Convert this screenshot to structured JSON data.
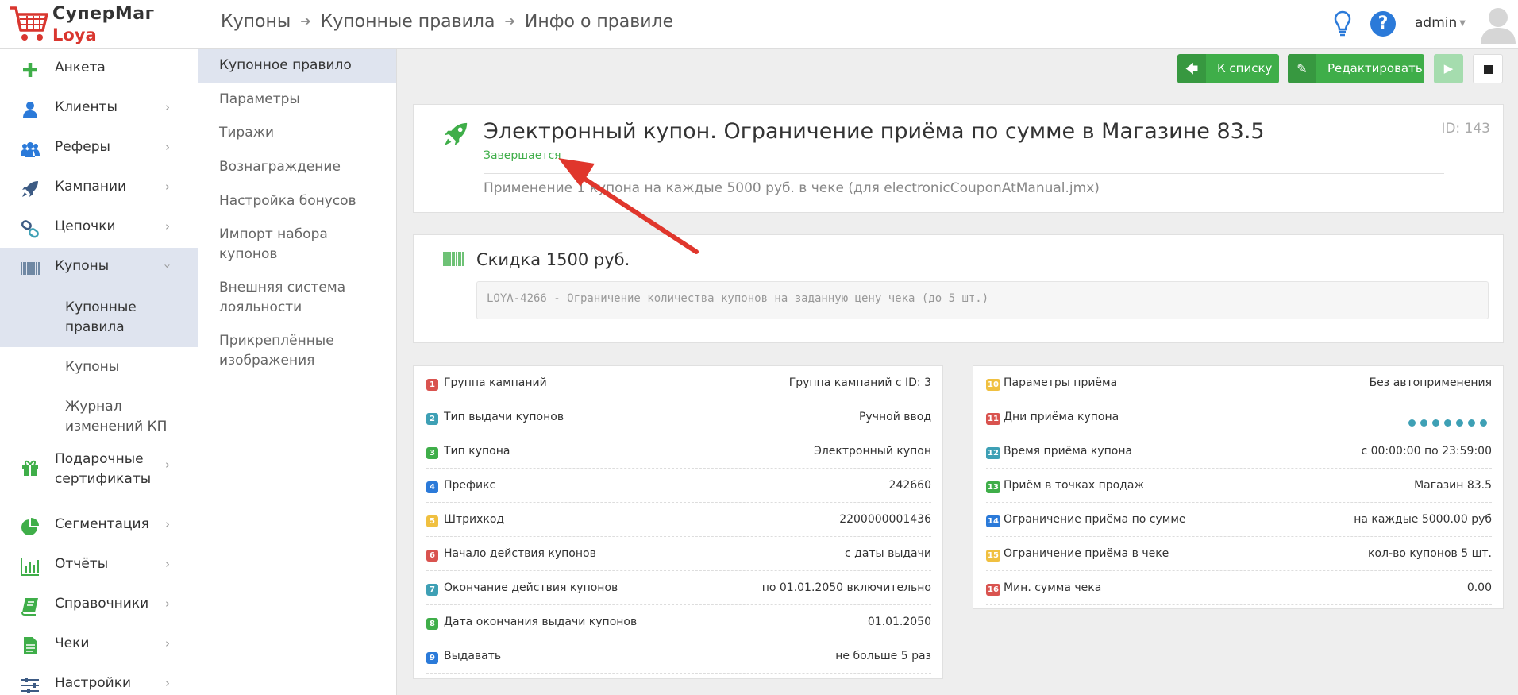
{
  "header": {
    "logo_line1": "СуперМаг",
    "logo_line2": "Loya",
    "breadcrumb": [
      "Купоны",
      "Купонные правила",
      "Инфо о правиле"
    ],
    "user": "admin"
  },
  "sidebar": {
    "items": [
      {
        "label": "Анкета",
        "icon": "plus-icon"
      },
      {
        "label": "Клиенты",
        "icon": "user-icon"
      },
      {
        "label": "Реферы",
        "icon": "users-icon"
      },
      {
        "label": "Кампании",
        "icon": "rocket-icon"
      },
      {
        "label": "Цепочки",
        "icon": "link-icon"
      },
      {
        "label": "Купоны",
        "icon": "barcode-icon"
      },
      {
        "label": "Подарочные сертификаты",
        "icon": "gift-icon"
      },
      {
        "label": "Сегментация",
        "icon": "pie-chart-icon"
      },
      {
        "label": "Отчёты",
        "icon": "bar-chart-icon"
      },
      {
        "label": "Справочники",
        "icon": "book-icon"
      },
      {
        "label": "Чеки",
        "icon": "receipt-icon"
      },
      {
        "label": "Настройки",
        "icon": "sliders-icon"
      }
    ],
    "sub_items": [
      "Купонные правила",
      "Купоны",
      "Журнал изменений КП"
    ]
  },
  "menu2": {
    "items": [
      "Купонное правило",
      "Параметры",
      "Тиражи",
      "Вознаграждение",
      "Настройка бонусов",
      "Импорт набора купонов",
      "Внешняя система лояльности",
      "Прикреплённые изображения"
    ]
  },
  "toolbar": {
    "back_label": "К списку",
    "edit_label": "Редактировать"
  },
  "rule": {
    "title": "Электронный купон. Ограничение приёма по сумме в Магазине 83.5",
    "status": "Завершается",
    "id": "ID: 143",
    "description": "Применение 1 купона на каждые 5000 руб. в чеке (для electronicCouponAtManual.jmx)"
  },
  "reward": {
    "title": "Скидка 1500 руб.",
    "code": "LOYA-4266 - Ограничение количества купонов на заданную цену чека (до 5 шт.)"
  },
  "params_left": [
    {
      "n": "1",
      "color": "#d9534f",
      "k": "Группа кампаний",
      "v": "Группа кампаний с ID: 3"
    },
    {
      "n": "2",
      "color": "#3ea0b5",
      "k": "Тип выдачи купонов",
      "v": "Ручной ввод"
    },
    {
      "n": "3",
      "color": "#3fae49",
      "k": "Тип купона",
      "v": "Электронный купон"
    },
    {
      "n": "4",
      "color": "#2b7ad9",
      "k": "Префикс",
      "v": "242660"
    },
    {
      "n": "5",
      "color": "#f0c040",
      "k": "Штрихкод",
      "v": "2200000001436"
    },
    {
      "n": "6",
      "color": "#d9534f",
      "k": "Начало действия купонов",
      "v": "с даты выдачи"
    },
    {
      "n": "7",
      "color": "#3ea0b5",
      "k": "Окончание действия купонов",
      "v": "по 01.01.2050 включительно"
    },
    {
      "n": "8",
      "color": "#3fae49",
      "k": "Дата окончания выдачи купонов",
      "v": "01.01.2050"
    },
    {
      "n": "9",
      "color": "#2b7ad9",
      "k": "Выдавать",
      "v": "не больше 5 раз"
    }
  ],
  "params_right": [
    {
      "n": "10",
      "color": "#f0c040",
      "k": "Параметры приёма",
      "v": "Без автоприменения"
    },
    {
      "n": "11",
      "color": "#d9534f",
      "k": "Дни приёма купона",
      "v": ""
    },
    {
      "n": "12",
      "color": "#3ea0b5",
      "k": "Время приёма купона",
      "v": "с 00:00:00 по 23:59:00"
    },
    {
      "n": "13",
      "color": "#3fae49",
      "k": "Приём в точках продаж",
      "v": "Магазин 83.5"
    },
    {
      "n": "14",
      "color": "#2b7ad9",
      "k": "Ограничение приёма по сумме",
      "v": "на каждые 5000.00 руб"
    },
    {
      "n": "15",
      "color": "#f0c040",
      "k": "Ограничение приёма в чеке",
      "v": "кол-во купонов 5 шт."
    },
    {
      "n": "16",
      "color": "#d9534f",
      "k": "Мин. сумма чека",
      "v": "0.00"
    }
  ],
  "colors": {
    "accent_green": "#3fae49",
    "active_bg": "#dfe4ef",
    "annotation": "#e0362c"
  }
}
